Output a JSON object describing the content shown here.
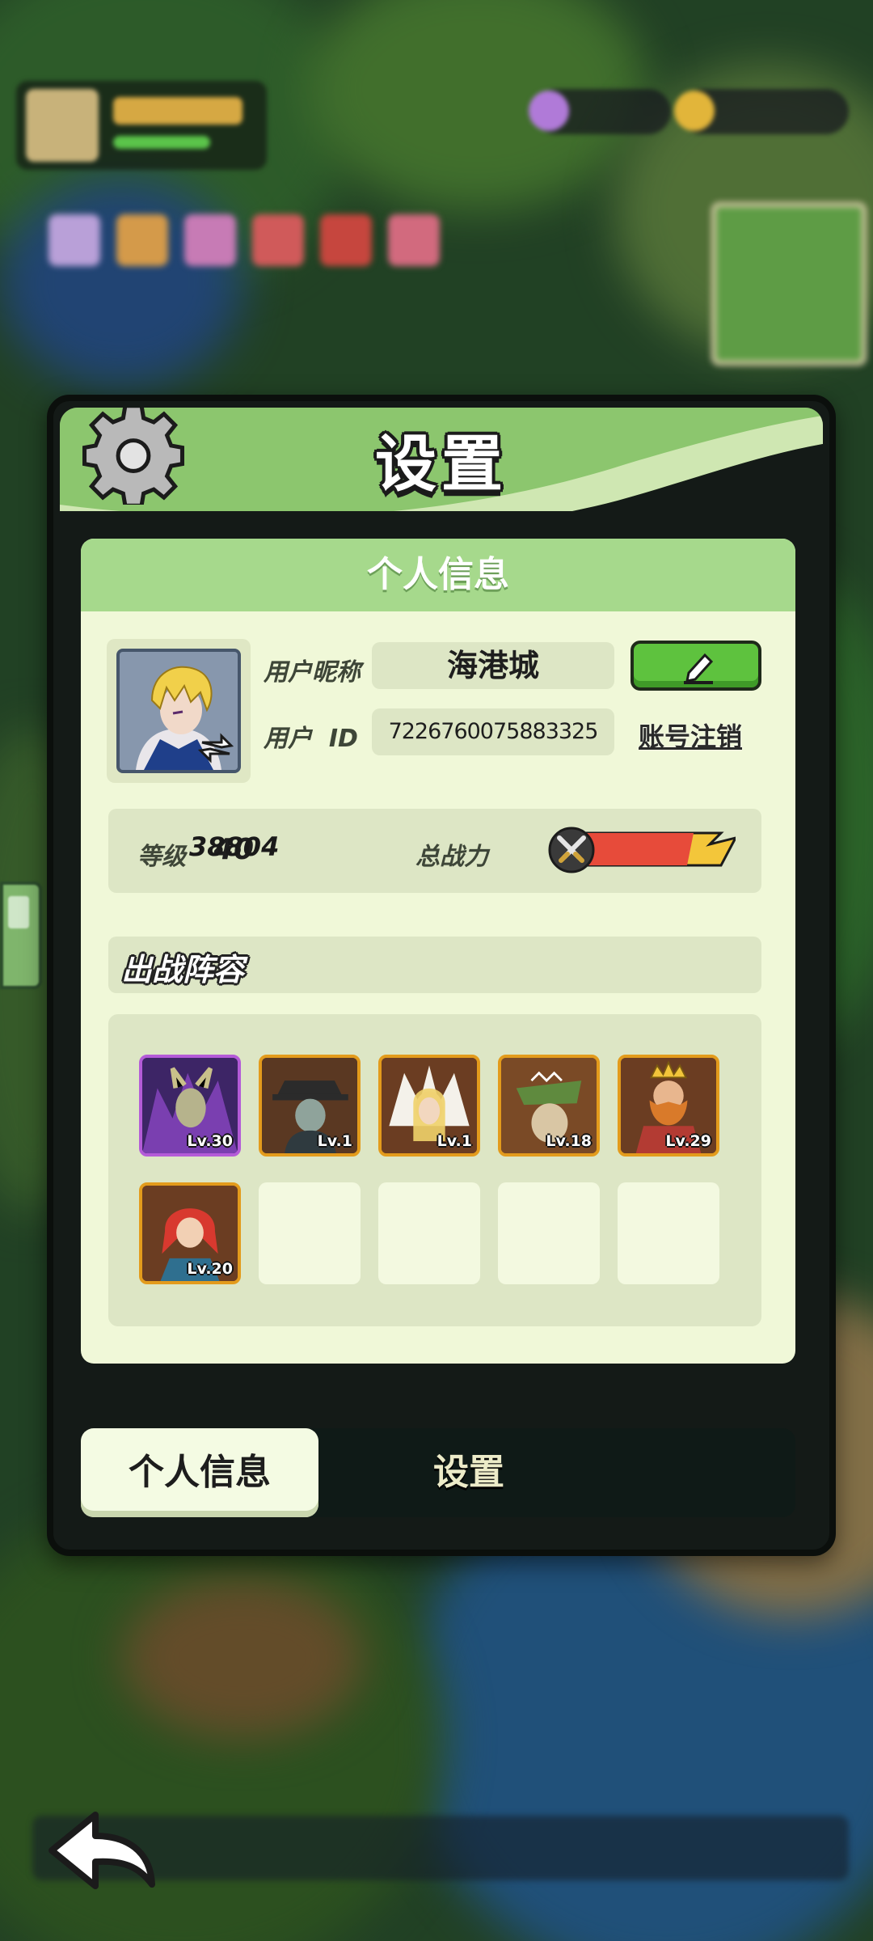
{
  "dialog": {
    "title": "设置",
    "panel_title": "个人信息"
  },
  "profile": {
    "nickname_label": "用户昵称",
    "nickname": "海港城",
    "id_label": "用户  ID",
    "user_id": "7226760075883325",
    "cancel_account_label": "账号注销"
  },
  "stats": {
    "level_label": "等级",
    "level": "40",
    "power_label": "总战力",
    "power": "38804"
  },
  "lineup": {
    "title": "出战阵容",
    "heroes": [
      {
        "level": "Lv.30",
        "frame": "purple"
      },
      {
        "level": "Lv.1",
        "frame": "orange"
      },
      {
        "level": "Lv.1",
        "frame": "orange"
      },
      {
        "level": "Lv.18",
        "frame": "orange"
      },
      {
        "level": "Lv.29",
        "frame": "orange"
      },
      {
        "level": "Lv.20",
        "frame": "orange"
      }
    ],
    "empty_slots": 4
  },
  "tabs": [
    {
      "label": "个人信息",
      "active": true
    },
    {
      "label": "设置",
      "active": false
    }
  ],
  "colors": {
    "header_green": "#8cc66e",
    "panel_bg": "#f0f8d8",
    "edit_button": "#5ec23e",
    "hero_frame_orange": "#e39b1c",
    "hero_frame_purple": "#b45bd8"
  },
  "icons": {
    "header": "gear-icon",
    "edit": "pencil-icon",
    "swap": "swap-icon",
    "power": "crossed-swords-icon",
    "back": "back-arrow-icon"
  }
}
